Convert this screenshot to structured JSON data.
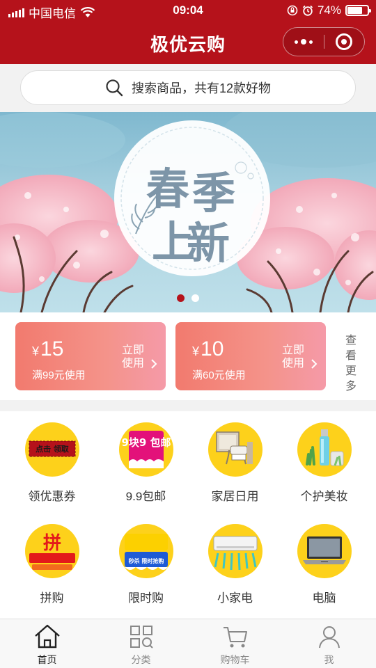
{
  "status": {
    "carrier": "中国电信",
    "time": "09:04",
    "battery": "74%",
    "battery_level": 0.74
  },
  "nav": {
    "title": "极优云购"
  },
  "search": {
    "placeholder": "搜索商品，共有12款好物"
  },
  "banner": {
    "chars": [
      "春",
      "季",
      "上",
      "新"
    ],
    "pages": 2,
    "active_page": 1
  },
  "coupons": [
    {
      "currency": "¥",
      "amount": "15",
      "condition": "满99元使用",
      "action": "立即使用"
    },
    {
      "currency": "¥",
      "amount": "10",
      "condition": "满60元使用",
      "action": "立即使用"
    }
  ],
  "coupon_more": "查看更多",
  "categories": [
    {
      "label": "领优惠券",
      "icon": "coupon-icon",
      "badge": "点击 领取"
    },
    {
      "label": "9.9包邮",
      "icon": "free-shipping-icon",
      "badge": "9块9 包邮"
    },
    {
      "label": "家居日用",
      "icon": "home-goods-icon"
    },
    {
      "label": "个护美妆",
      "icon": "cosmetics-icon"
    },
    {
      "label": "拼购",
      "icon": "group-buy-icon",
      "badge": "拼"
    },
    {
      "label": "限时购",
      "icon": "flash-sale-icon",
      "badge": "秒杀 限时抢购"
    },
    {
      "label": "小家电",
      "icon": "air-conditioner-icon"
    },
    {
      "label": "电脑",
      "icon": "laptop-icon"
    }
  ],
  "tabs": [
    {
      "label": "首页",
      "icon": "home-icon",
      "active": true
    },
    {
      "label": "分类",
      "icon": "category-icon",
      "active": false
    },
    {
      "label": "购物车",
      "icon": "cart-icon",
      "active": false
    },
    {
      "label": "我",
      "icon": "user-icon",
      "active": false
    }
  ],
  "colors": {
    "brand": "#b5121b",
    "coupon_start": "#f27a6e",
    "coupon_end": "#f59aa8",
    "icon_bg": "#fdd11b"
  }
}
